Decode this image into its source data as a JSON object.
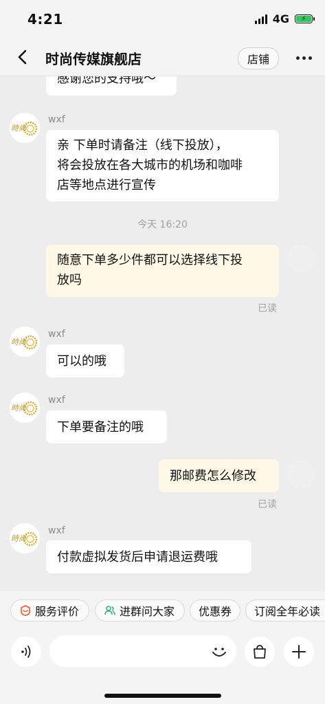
{
  "status_bar": {
    "time": "4:21",
    "network": "4G"
  },
  "header": {
    "title": "时尚传媒旗舰店",
    "store_label": "店铺"
  },
  "messages": [
    {
      "text": "感谢您的支持哦～",
      "side": "left"
    },
    {
      "sender": "wxf",
      "text_lines": [
        "亲  下单时请备注（线下投放），",
        "将会投放在各大城市的机场和咖啡",
        "店等地点进行宣传"
      ],
      "side": "left"
    },
    {
      "text": "今天 16:20",
      "type": "timestamp"
    },
    {
      "text_lines": [
        "随意下单多少件都可以选择线下投",
        "放吗"
      ],
      "side": "right",
      "read": "已读"
    },
    {
      "sender": "wxf",
      "text": "可以的哦",
      "side": "left"
    },
    {
      "sender": "wxf",
      "text": "下单要备注的哦",
      "side": "left"
    },
    {
      "text": "那邮费怎么修改",
      "side": "right",
      "read": "已读"
    },
    {
      "sender": "wxf",
      "text": "付款虚拟发货后申请退运费哦",
      "side": "left"
    }
  ],
  "shop_avatar_text": "時尚",
  "quick_actions": [
    {
      "label": "服务评价",
      "icon": "review-icon"
    },
    {
      "label": "进群问大家",
      "icon": "group-icon"
    },
    {
      "label": "优惠券"
    },
    {
      "label": "订阅全年必读"
    }
  ],
  "input": {
    "value": ""
  },
  "colors": {
    "background": "#EDEDED",
    "bubble_left": "#FFFFFF",
    "bubble_right": "#FFF8E6",
    "accent": "#F05A28",
    "group_icon": "#36B37E",
    "battery": "#32C759"
  }
}
